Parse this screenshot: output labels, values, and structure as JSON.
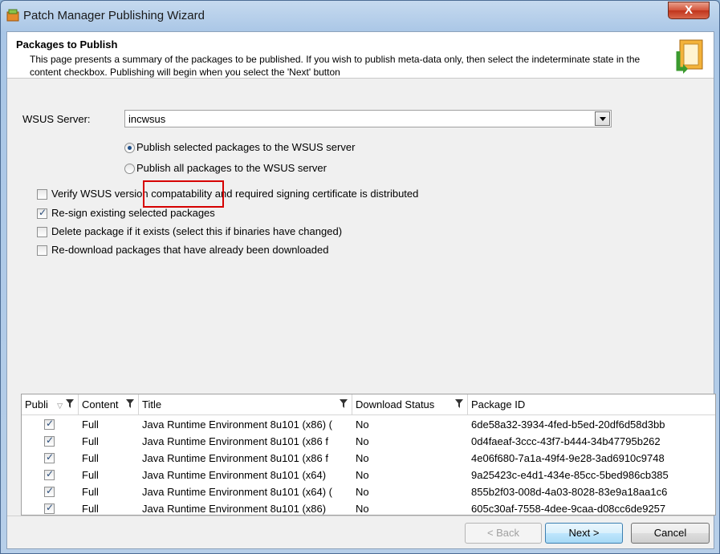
{
  "window": {
    "title": "Patch Manager Publishing Wizard",
    "close_label": "X"
  },
  "header": {
    "title": "Packages to Publish",
    "description": "This page presents a summary of the packages to be published. If you wish to publish meta-data only, then select the indeterminate state in the content checkbox. Publishing will begin when you select the 'Next' button"
  },
  "server": {
    "label": "WSUS Server:",
    "value": "incwsus"
  },
  "radios": [
    {
      "label": "Publish selected packages to the WSUS server",
      "checked": true
    },
    {
      "label": "Publish all packages to the WSUS server",
      "checked": false
    }
  ],
  "checkboxes": [
    {
      "label": "Verify WSUS version compatability and required signing certificate is distributed",
      "checked": false
    },
    {
      "label": "Re-sign existing selected packages",
      "checked": true
    },
    {
      "label": "Delete package if it exists (select this if binaries have changed)",
      "checked": false
    },
    {
      "label": "Re-download packages that have already been downloaded",
      "checked": false
    }
  ],
  "grid": {
    "columns": [
      "Publi",
      "Content",
      "Title",
      "Download Status",
      "Package ID"
    ],
    "rows": [
      {
        "content": "Full",
        "title": "Java Runtime Environment 8u101 (x86) (",
        "status": "No",
        "id": "6de58a32-3934-4fed-b5ed-20df6d58d3bb"
      },
      {
        "content": "Full",
        "title": "Java Runtime Environment 8u101 (x86 f",
        "status": "No",
        "id": "0d4faeaf-3ccc-43f7-b444-34b47795b262"
      },
      {
        "content": "Full",
        "title": "Java Runtime Environment 8u101 (x86 f",
        "status": "No",
        "id": "4e06f680-7a1a-49f4-9e28-3ad6910c9748"
      },
      {
        "content": "Full",
        "title": "Java Runtime Environment 8u101 (x64)",
        "status": "No",
        "id": "9a25423c-e4d1-434e-85cc-5bed986cb385"
      },
      {
        "content": "Full",
        "title": "Java Runtime Environment 8u101 (x64) (",
        "status": "No",
        "id": "855b2f03-008d-4a03-8028-83e9a18aa1c6"
      },
      {
        "content": "Full",
        "title": "Java Runtime Environment 8u101 (x86)",
        "status": "No",
        "id": "605c30af-7558-4dee-9caa-d08cc6de9257"
      }
    ]
  },
  "buttons": {
    "back": "< Back",
    "next": "Next >",
    "cancel": "Cancel"
  },
  "colors": {
    "highlight": "#d60000",
    "accent": "#3c7fb1"
  }
}
